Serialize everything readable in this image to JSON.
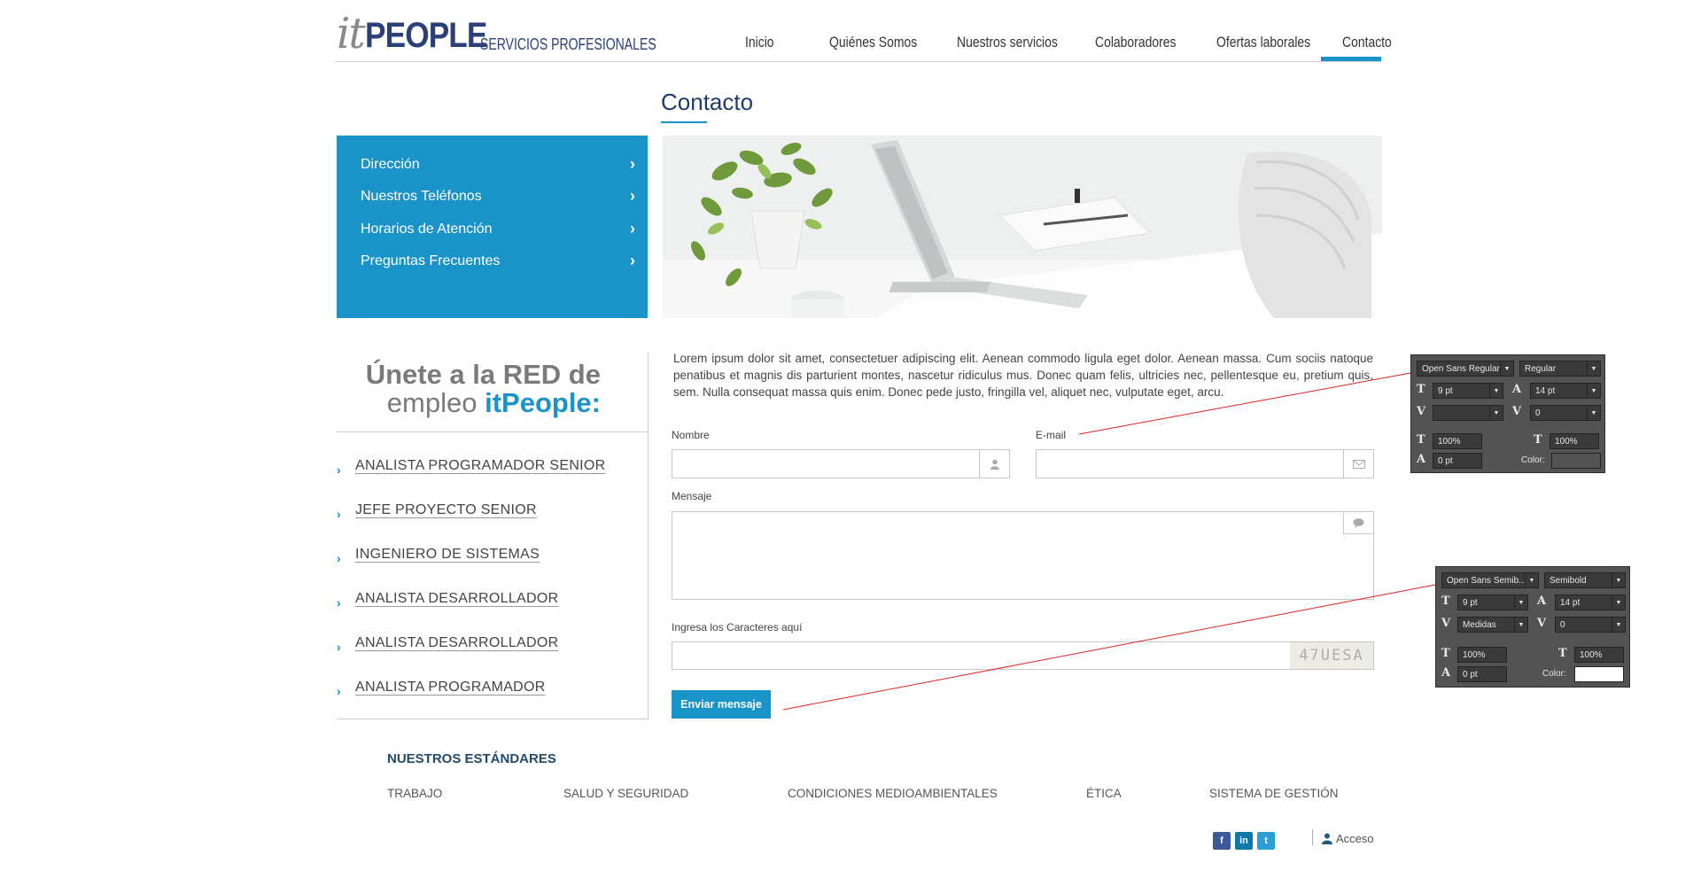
{
  "header": {
    "logo_it": "it",
    "logo_people": "PEOPLE",
    "logo_tagline": "SERVICIOS PROFESIONALES",
    "nav": [
      "Inicio",
      "Quiénes Somos",
      "Nuestros servicios",
      "Colaboradores",
      "Ofertas laborales",
      "Contacto"
    ],
    "active_nav": "Contacto"
  },
  "page": {
    "title": "Contacto"
  },
  "side_menu": {
    "items": [
      "Dirección",
      "Nuestros Teléfonos",
      "Horarios de Atención",
      "Preguntas Frecuentes"
    ]
  },
  "join": {
    "title": "Únete a la RED de",
    "sub_prefix": "empleo ",
    "sub_brand": "itPeople:",
    "jobs": [
      "ANALISTA PROGRAMADOR SENIOR",
      "JEFE PROYECTO SENIOR",
      "INGENIERO DE SISTEMAS",
      "ANALISTA DESARROLLADOR",
      "ANALISTA DESARROLLADOR",
      "ANALISTA PROGRAMADOR"
    ]
  },
  "content": {
    "intro": "Lorem ipsum dolor sit amet, consectetuer adipiscing elit. Aenean commodo ligula eget dolor. Aenean massa. Cum sociis natoque penatibus et magnis dis parturient montes, nascetur ridiculus mus. Donec quam felis, ultricies nec, pellentesque eu, pretium quis, sem. Nulla consequat massa quis enim. Donec pede justo, fringilla vel, aliquet nec, vulputate eget, arcu."
  },
  "form": {
    "name_label": "Nombre",
    "email_label": "E-mail",
    "message_label": "Mensaje",
    "captcha_label": "Ingresa los Caracteres aquí",
    "captcha_text": "47UESA",
    "submit_label": "Enviar mensaje"
  },
  "standards": {
    "title": "NUESTROS ESTÁNDARES",
    "items": [
      "TRABAJO",
      "SALUD Y SEGURIDAD",
      "CONDICIONES MEDIOAMBIENTALES",
      "ÉTICA",
      "SISTEMA DE GESTIÓN"
    ]
  },
  "footer": {
    "social": [
      "facebook-icon",
      "linkedin-icon",
      "twitter-icon"
    ],
    "login_label": "Acceso"
  },
  "annotations": {
    "panel1": {
      "font": "Open Sans Regular",
      "style": "Regular",
      "size": "9 pt",
      "leading": "14 pt",
      "kerning": "",
      "tracking": "0",
      "vscale": "100%",
      "hscale": "100%",
      "baseline": "0 pt",
      "color_label": "Color:"
    },
    "panel2": {
      "font": "Open Sans Semib...",
      "style": "Semibold",
      "size": "9 pt",
      "leading": "14 pt",
      "kerning": "Medidas",
      "tracking": "0",
      "vscale": "100%",
      "hscale": "100%",
      "baseline": "0 pt",
      "color_label": "Color:"
    }
  },
  "colors": {
    "accent": "#1a93c8",
    "brand_dark": "#2b3f7a",
    "title": "#1f3a6d"
  }
}
